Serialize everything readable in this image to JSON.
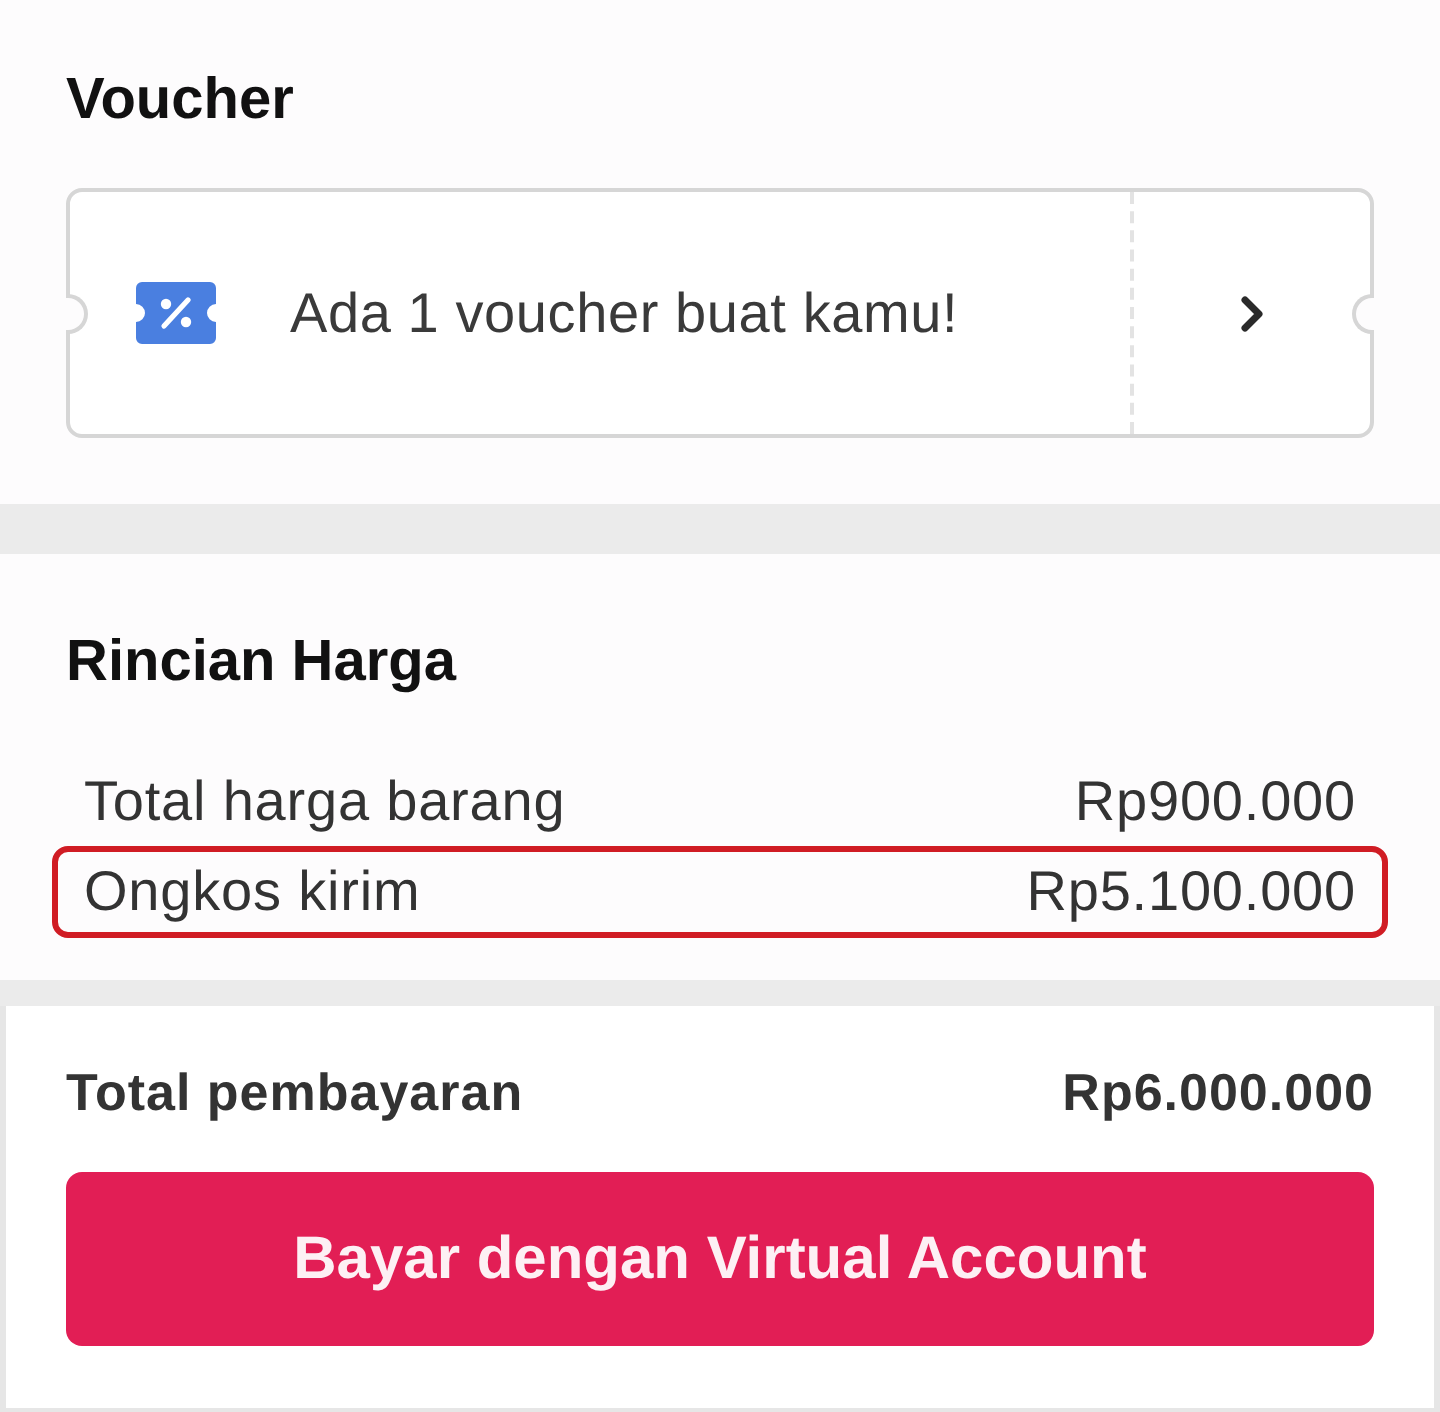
{
  "voucher": {
    "title": "Voucher",
    "message": "Ada 1 voucher buat kamu!"
  },
  "price_details": {
    "title": "Rincian Harga",
    "rows": [
      {
        "label": "Total harga barang",
        "value": "Rp900.000",
        "highlighted": false
      },
      {
        "label": "Ongkos kirim",
        "value": "Rp5.100.000",
        "highlighted": true
      }
    ]
  },
  "total": {
    "label": "Total pembayaran",
    "value": "Rp6.000.000"
  },
  "pay_button": {
    "label": "Bayar dengan Virtual Account"
  }
}
